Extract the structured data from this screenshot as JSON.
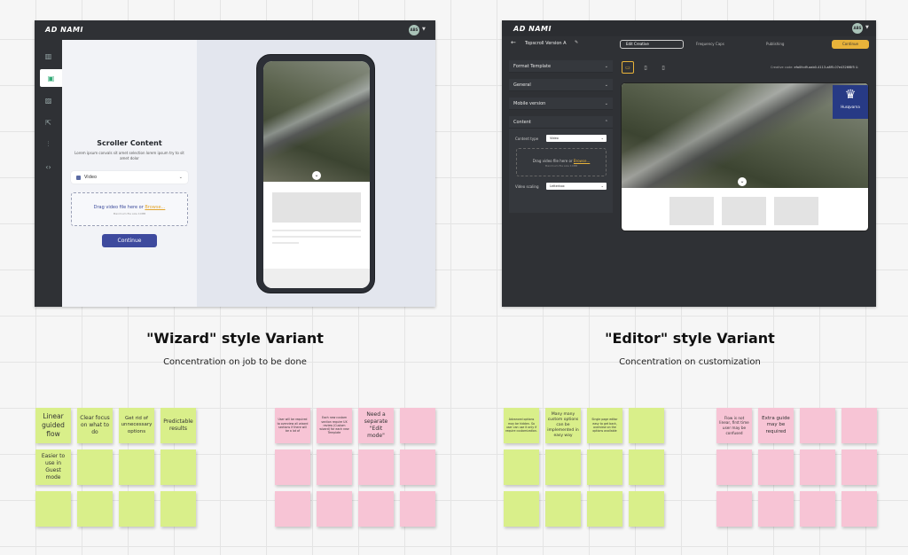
{
  "wizard": {
    "logo": "AD NAMI",
    "avatar": "ABS",
    "panel": {
      "title": "Scroller Content",
      "description": "Lorem ipsum convals sit amet selection lorem ipsum try to sit amet dolor",
      "select_value": "Video",
      "drop_text": "Drag video file here or",
      "drop_link": "Browse...",
      "drop_sub": "Maximum file size 10MB",
      "continue_label": "Continue"
    },
    "heading": "\"Wizard\" style Variant",
    "subheading": "Concentration on job to be done"
  },
  "editor": {
    "logo": "AD NAMI",
    "avatar": "ABS",
    "format_name": "Topscroll Version A",
    "steps": [
      "Edit Creative",
      "Frequency Caps",
      "Publishing"
    ],
    "continue_label": "Continue",
    "sections": [
      "Format Template",
      "General",
      "Mobile version",
      "Content"
    ],
    "content_type_label": "Content type",
    "content_type_value": "Video",
    "drop_text": "Drag video file here or",
    "drop_link": "Browse...",
    "drop_sub": "Maximum file size 10MB",
    "video_scaling_label": "Video scaling",
    "video_scaling_value": "Letterbox",
    "creative_code_label": "Creative code:",
    "creative_code_value": "efa0fcd9-aab0-4113-a8f5-07e4326f8f5",
    "brand_name": "Husqvarna",
    "heading": "\"Editor\" style Variant",
    "subheading": "Concentration on customization"
  },
  "stickies": {
    "wizard_pros": [
      "Linear guided flow",
      "Clear focus on what to do",
      "Get rid of unnecessary options",
      "Predictable results",
      "Easier to use in Guest mode"
    ],
    "wizard_cons": [
      "User will be required to overview all wizard sections if there will be a lot of",
      "Each new custom section require UX review (Custom wizard) for each new Template",
      "Need a separate \"Edit mode\""
    ],
    "editor_pros": [
      "Advanced options may be hidden. So user can use it only if require customization.",
      "Many many custom options can be implemented in easy way",
      "Single page editor easy to get back, overview on the options available"
    ],
    "editor_cons": [
      "Flow is not linear, first time user may be confused",
      "Extra guide may be required"
    ]
  }
}
